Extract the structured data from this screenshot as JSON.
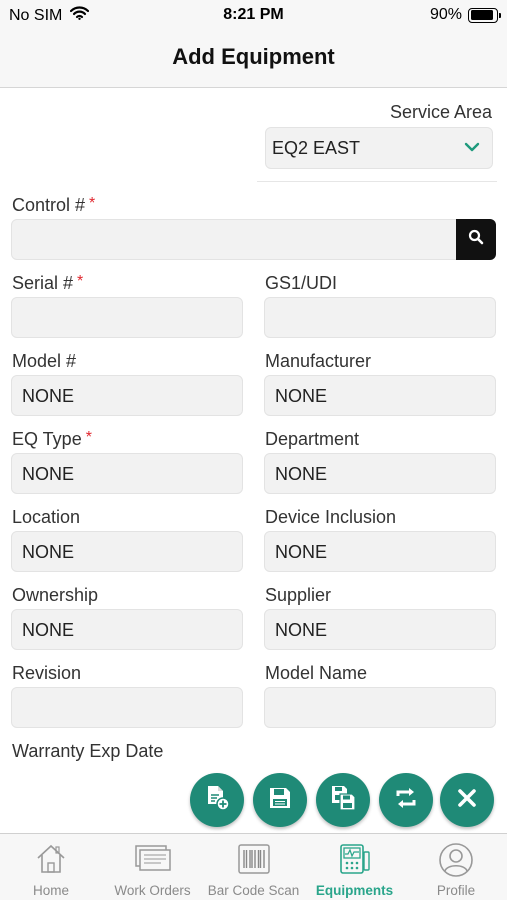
{
  "status_bar": {
    "carrier": "No SIM",
    "time": "8:21 PM",
    "battery_text": "90%",
    "battery_level": 0.9
  },
  "nav": {
    "title": "Add Equipment"
  },
  "service_area": {
    "label": "Service Area",
    "value": "EQ2 EAST"
  },
  "fields": {
    "control": {
      "label": "Control #",
      "required_mark": "*",
      "value": ""
    },
    "serial": {
      "label": "Serial #",
      "required_mark": "*",
      "value": ""
    },
    "gs1": {
      "label": "GS1/UDI",
      "value": ""
    },
    "model": {
      "label": "Model #",
      "value": "NONE"
    },
    "manufacturer": {
      "label": "Manufacturer",
      "value": "NONE"
    },
    "eq_type": {
      "label": "EQ Type",
      "required_mark": "*",
      "value": "NONE"
    },
    "department": {
      "label": "Department",
      "value": "NONE"
    },
    "location": {
      "label": "Location",
      "value": "NONE"
    },
    "device_inclusion": {
      "label": "Device Inclusion",
      "value": "NONE"
    },
    "ownership": {
      "label": "Ownership",
      "value": "NONE"
    },
    "supplier": {
      "label": "Supplier",
      "value": "NONE"
    },
    "revision": {
      "label": "Revision",
      "value": ""
    },
    "model_name": {
      "label": "Model Name",
      "value": ""
    },
    "warranty": {
      "label": "Warranty Exp Date"
    }
  },
  "colors": {
    "accent": "#1f8a77",
    "active_tab": "#2aa58b",
    "required": "#e0262e"
  },
  "tabs": [
    {
      "label": "Home",
      "icon": "home-icon",
      "active": false
    },
    {
      "label": "Work Orders",
      "icon": "work-orders-icon",
      "active": false
    },
    {
      "label": "Bar Code Scan",
      "icon": "barcode-icon",
      "active": false
    },
    {
      "label": "Equipments",
      "icon": "equipment-icon",
      "active": true
    },
    {
      "label": "Profile",
      "icon": "profile-icon",
      "active": false
    }
  ],
  "actions": [
    "add-document-icon",
    "save-icon",
    "copy-icon",
    "refresh-icon",
    "close-icon"
  ]
}
